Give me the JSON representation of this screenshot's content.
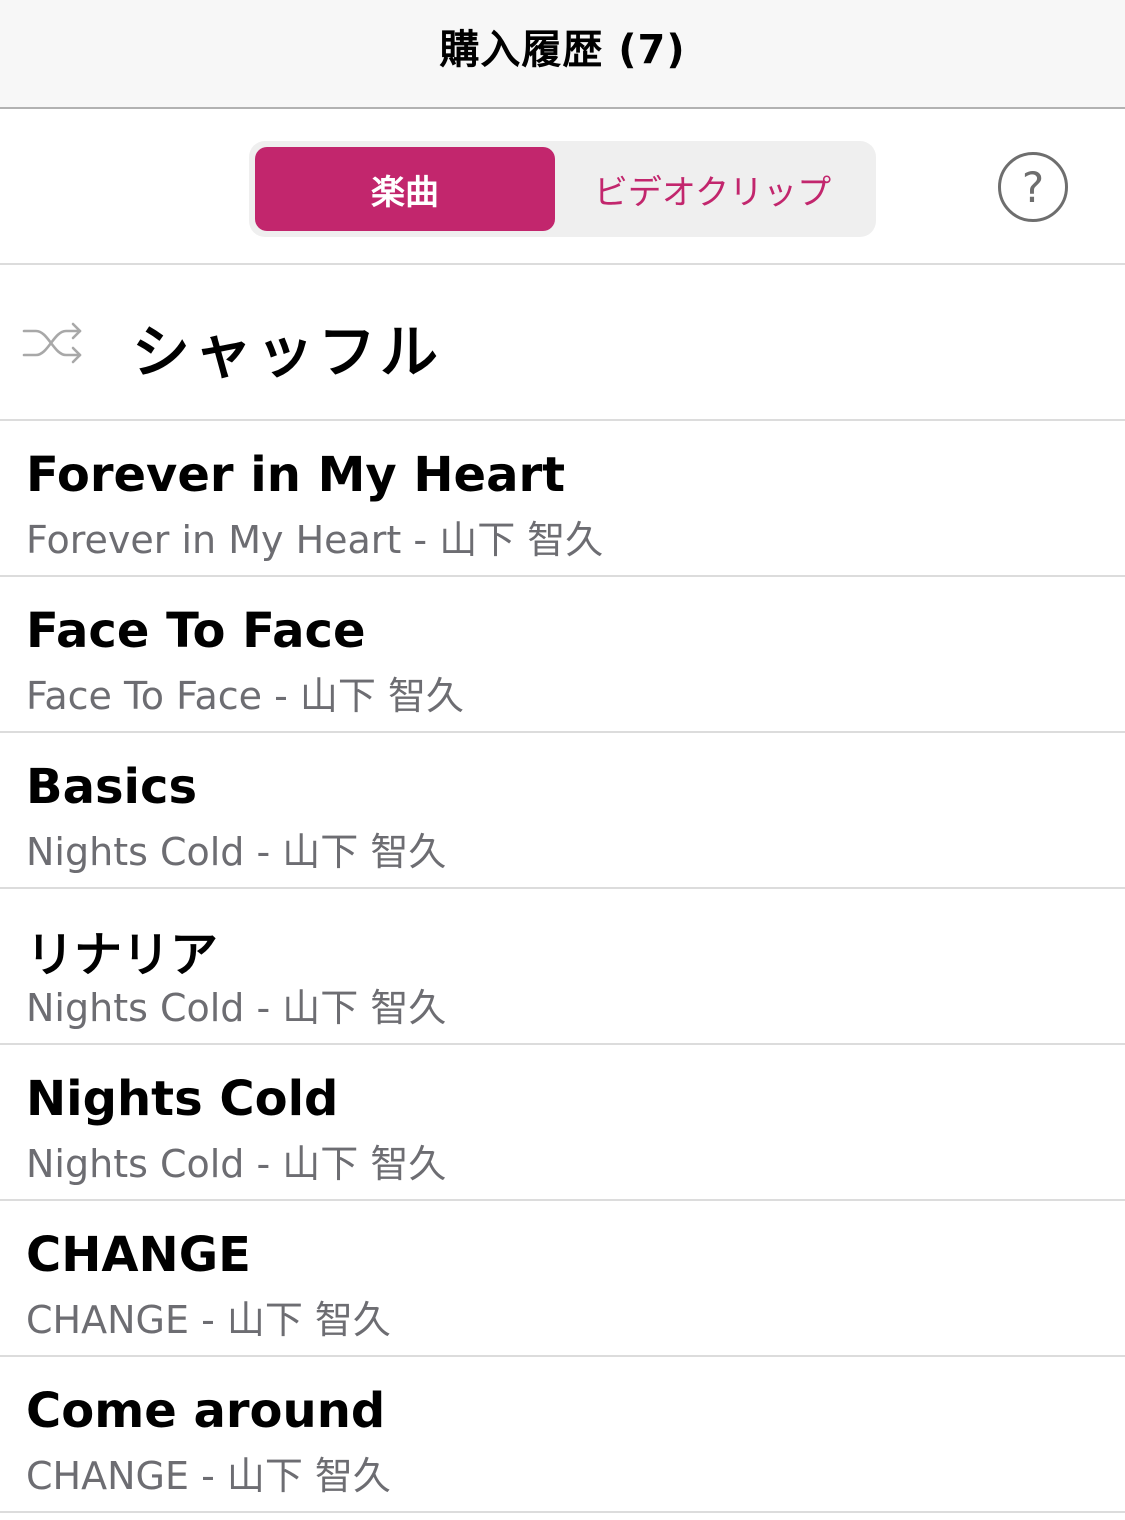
{
  "header": {
    "title": "購入履歴 (7)"
  },
  "segments": {
    "songs_label": "楽曲",
    "videos_label": "ビデオクリップ",
    "help_label": "?",
    "selected": "楽曲"
  },
  "shuffle": {
    "label": "シャッフル",
    "icon": "shuffle-icon"
  },
  "colors": {
    "accent": "#c2266d",
    "secondary_text": "#6d6d72"
  },
  "songs": [
    {
      "title": "Forever in My Heart",
      "subtitle": "Forever in My Heart - 山下 智久"
    },
    {
      "title": "Face To Face",
      "subtitle": "Face To Face - 山下 智久"
    },
    {
      "title": "Basics",
      "subtitle": "Nights Cold - 山下 智久"
    },
    {
      "title": "リナリア",
      "subtitle": "Nights Cold - 山下 智久"
    },
    {
      "title": "Nights Cold",
      "subtitle": "Nights Cold - 山下 智久"
    },
    {
      "title": "CHANGE",
      "subtitle": "CHANGE - 山下 智久"
    },
    {
      "title": "Come around",
      "subtitle": "CHANGE - 山下 智久"
    }
  ]
}
